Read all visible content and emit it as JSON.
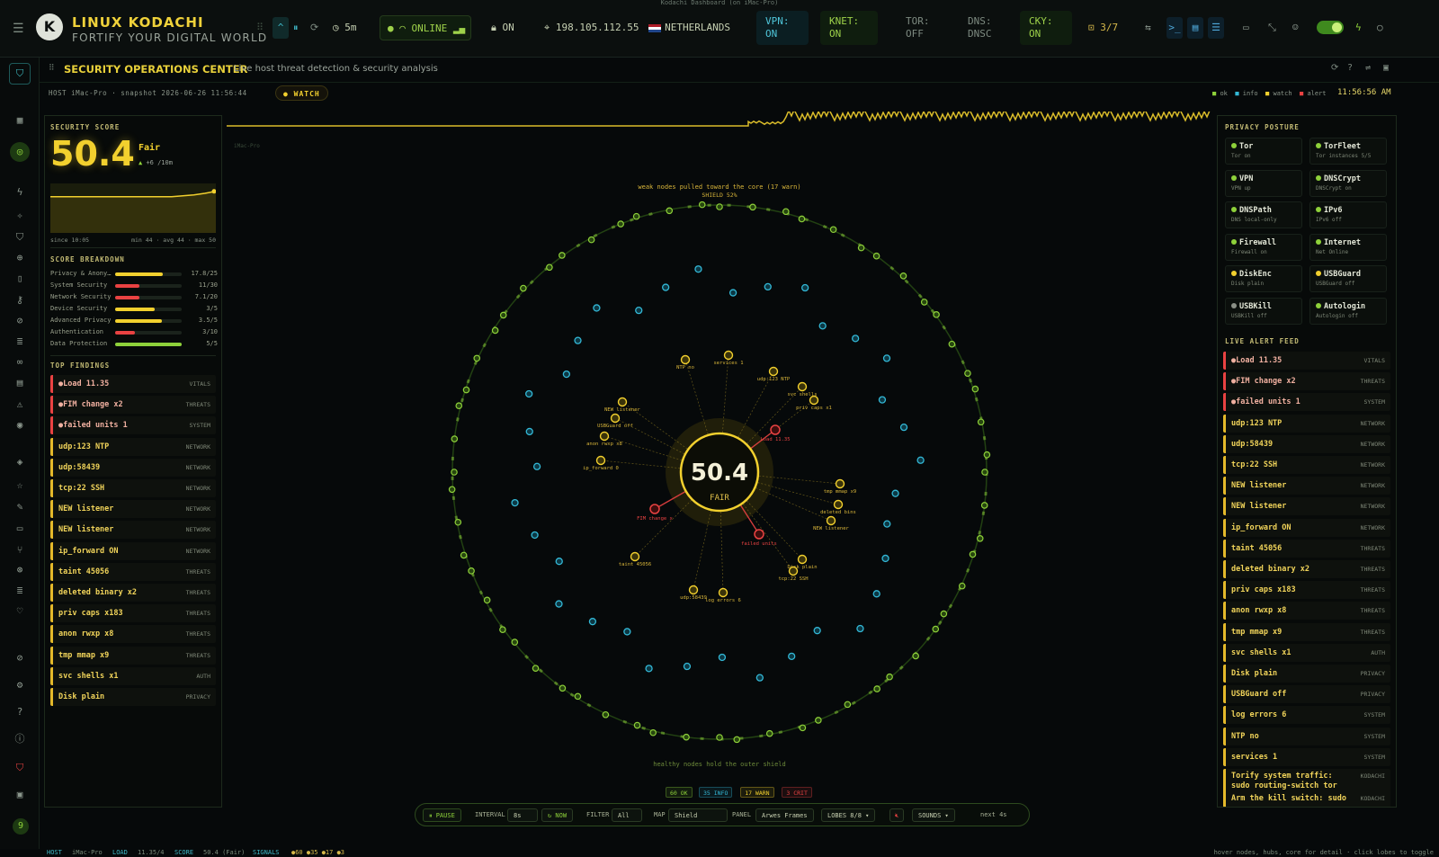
{
  "window_title": "Kodachi Dashboard (on iMac-Pro)",
  "brand": {
    "title": "LINUX KODACHI",
    "subtitle": "FORTIFY YOUR DIGITAL WORLD",
    "logo_letter": "K"
  },
  "topbar": {
    "interval": "5m",
    "online": "ONLINE",
    "lock": "ON",
    "ip": "198.105.112.55",
    "country": "NETHERLANDS",
    "vpn": "VPN:\nON",
    "knet": "KNET:\nON",
    "tor": "TOR:\nOFF",
    "dns": "DNS:\nDNSC",
    "cky": "CKY:\nON",
    "lock_count": "3/7"
  },
  "header": {
    "title": "SECURITY OPERATIONS CENTER",
    "subtitle": "Live host threat detection & security analysis"
  },
  "subheader": {
    "host_info": "HOST iMac-Pro · snapshot 2026-06-26 11:56:44",
    "status": "WATCH",
    "legend": [
      "ok",
      "info",
      "watch",
      "alert"
    ],
    "clock": "11:56:56 AM"
  },
  "score": {
    "label": "SECURITY SCORE",
    "value": "50.4",
    "grade": "Fair",
    "delta": "+6 /10m",
    "since": "since 10:05",
    "stats": "min 44 · avg 44 · max 50",
    "sparkline": [
      44,
      44,
      44,
      44,
      44,
      44,
      44,
      44,
      44,
      44,
      44,
      44,
      45,
      46,
      48,
      50.4
    ],
    "breakdown_title": "SCORE BREAKDOWN",
    "breakdown": [
      {
        "name": "Privacy & Anony…",
        "value": "17.8/25",
        "frac": 0.71,
        "color": "#f2d02e"
      },
      {
        "name": "System Security",
        "value": "11/30",
        "frac": 0.37,
        "color": "#e94242"
      },
      {
        "name": "Network Security",
        "value": "7.1/20",
        "frac": 0.36,
        "color": "#e94242"
      },
      {
        "name": "Device Security",
        "value": "3/5",
        "frac": 0.6,
        "color": "#f2d02e"
      },
      {
        "name": "Advanced Privacy",
        "value": "3.5/5",
        "frac": 0.7,
        "color": "#f2d02e"
      },
      {
        "name": "Authentication",
        "value": "3/10",
        "frac": 0.3,
        "color": "#e94242"
      },
      {
        "name": "Data Protection",
        "value": "5/5",
        "frac": 1.0,
        "color": "#8ed13a"
      }
    ]
  },
  "findings": {
    "title": "TOP FINDINGS",
    "items": [
      {
        "text": "●Load 11.35",
        "cat": "VITALS",
        "color": "#e94242"
      },
      {
        "text": "●FIM change x2",
        "cat": "THREATS",
        "color": "#e94242"
      },
      {
        "text": "●failed units 1",
        "cat": "SYSTEM",
        "color": "#e94242"
      },
      {
        "text": "udp:123 NTP",
        "cat": "NETWORK",
        "color": "#e4b92a"
      },
      {
        "text": "udp:58439",
        "cat": "NETWORK",
        "color": "#e4b92a"
      },
      {
        "text": "tcp:22 SSH",
        "cat": "NETWORK",
        "color": "#e4b92a"
      },
      {
        "text": "NEW listener",
        "cat": "NETWORK",
        "color": "#e4b92a"
      },
      {
        "text": "NEW listener",
        "cat": "NETWORK",
        "color": "#e4b92a"
      },
      {
        "text": "ip_forward ON",
        "cat": "NETWORK",
        "color": "#e4b92a"
      },
      {
        "text": "taint 45056",
        "cat": "THREATS",
        "color": "#e4b92a"
      },
      {
        "text": "deleted binary x2",
        "cat": "THREATS",
        "color": "#e4b92a"
      },
      {
        "text": "priv caps x183",
        "cat": "THREATS",
        "color": "#e4b92a"
      },
      {
        "text": "anon rwxp x8",
        "cat": "THREATS",
        "color": "#e4b92a"
      },
      {
        "text": "tmp mmap x9",
        "cat": "THREATS",
        "color": "#e4b92a"
      },
      {
        "text": "svc shells x1",
        "cat": "AUTH",
        "color": "#e4b92a"
      },
      {
        "text": "Disk plain",
        "cat": "PRIVACY",
        "color": "#e4b92a"
      }
    ]
  },
  "viz": {
    "top_note": "weak nodes pulled toward the core (17 warn)",
    "shield": "SHIELD 52%",
    "core_value": "50.4",
    "core_label": "FAIR",
    "bottom_note": "healthy nodes hold the outer shield",
    "host_tag": "iMac-Pro",
    "warn_nodes": [
      "NTP no",
      "services 1",
      "udp:123 NTP",
      "svc shells",
      "priv caps x1",
      "NEW listener",
      "USBGuard off",
      "anon rwxp x8",
      "ip_forward 0",
      "tmp mmap x9",
      "deleted bins",
      "NEW listener",
      "Disk plain",
      "tcp:22 SSH",
      "taint 45056",
      "udp:58439",
      "log errors 6"
    ],
    "alert_nodes": [
      "Load 11.35",
      "FIM change x",
      "failed units"
    ],
    "counts": [
      {
        "label": "60 OK",
        "color": "#8ed13a"
      },
      {
        "label": "35 INFO",
        "color": "#33b8d6"
      },
      {
        "label": "17 WARN",
        "color": "#f2d02e"
      },
      {
        "label": "3 CRIT",
        "color": "#e94242"
      }
    ]
  },
  "posture": {
    "title": "PRIVACY POSTURE",
    "items": [
      {
        "name": "Tor",
        "sub": "Tor on",
        "color": "#8ed13a"
      },
      {
        "name": "TorFleet",
        "sub": "Tor instances 5/5",
        "color": "#8ed13a"
      },
      {
        "name": "VPN",
        "sub": "VPN up",
        "color": "#8ed13a"
      },
      {
        "name": "DNSCrypt",
        "sub": "DNSCrypt on",
        "color": "#8ed13a"
      },
      {
        "name": "DNSPath",
        "sub": "DNS local-only",
        "color": "#8ed13a"
      },
      {
        "name": "IPv6",
        "sub": "IPv6 off",
        "color": "#8ed13a"
      },
      {
        "name": "Firewall",
        "sub": "Firewall on",
        "color": "#8ed13a"
      },
      {
        "name": "Internet",
        "sub": "Net Online",
        "color": "#8ed13a"
      },
      {
        "name": "DiskEnc",
        "sub": "Disk plain",
        "color": "#f2d02e"
      },
      {
        "name": "USBGuard",
        "sub": "USBGuard off",
        "color": "#f2d02e"
      },
      {
        "name": "USBKill",
        "sub": "USBKill off",
        "color": "#8a8f86"
      },
      {
        "name": "Autologin",
        "sub": "Autologin off",
        "color": "#8ed13a"
      }
    ]
  },
  "feed": {
    "title": "LIVE ALERT FEED",
    "items": [
      {
        "text": "●Load 11.35",
        "cat": "VITALS",
        "color": "#e94242"
      },
      {
        "text": "●FIM change x2",
        "cat": "THREATS",
        "color": "#e94242"
      },
      {
        "text": "●failed units 1",
        "cat": "SYSTEM",
        "color": "#e94242"
      },
      {
        "text": "udp:123 NTP",
        "cat": "NETWORK",
        "color": "#e4b92a"
      },
      {
        "text": "udp:58439",
        "cat": "NETWORK",
        "color": "#e4b92a"
      },
      {
        "text": "tcp:22 SSH",
        "cat": "NETWORK",
        "color": "#e4b92a"
      },
      {
        "text": "NEW listener",
        "cat": "NETWORK",
        "color": "#e4b92a"
      },
      {
        "text": "NEW listener",
        "cat": "NETWORK",
        "color": "#e4b92a"
      },
      {
        "text": "ip_forward ON",
        "cat": "NETWORK",
        "color": "#e4b92a"
      },
      {
        "text": "taint 45056",
        "cat": "THREATS",
        "color": "#e4b92a"
      },
      {
        "text": "deleted binary x2",
        "cat": "THREATS",
        "color": "#e4b92a"
      },
      {
        "text": "priv caps x183",
        "cat": "THREATS",
        "color": "#e4b92a"
      },
      {
        "text": "anon rwxp x8",
        "cat": "THREATS",
        "color": "#e4b92a"
      },
      {
        "text": "tmp mmap x9",
        "cat": "THREATS",
        "color": "#e4b92a"
      },
      {
        "text": "svc shells x1",
        "cat": "AUTH",
        "color": "#e4b92a"
      },
      {
        "text": "Disk plain",
        "cat": "PRIVACY",
        "color": "#e4b92a"
      },
      {
        "text": "USBGuard off",
        "cat": "PRIVACY",
        "color": "#e4b92a"
      },
      {
        "text": "log errors 6",
        "cat": "SYSTEM",
        "color": "#e4b92a"
      },
      {
        "text": "NTP no",
        "cat": "SYSTEM",
        "color": "#e4b92a"
      },
      {
        "text": "services 1",
        "cat": "SYSTEM",
        "color": "#e4b92a"
      },
      {
        "text": "Torify system traffic: sudo routing-switch tor",
        "cat": "KODACHI",
        "color": "#e4b92a"
      },
      {
        "text": "Arm the kill switch: sudo",
        "cat": "KODACHI",
        "color": "#e4b92a"
      }
    ]
  },
  "controls": {
    "pause": "⏸ PAUSE",
    "interval_label": "INTERVAL",
    "interval_value": "8s",
    "now": "↻ NOW",
    "filter_label": "FILTER",
    "filter_value": "All",
    "map_label": "MAP",
    "map_value": "Shield",
    "panel_label": "PANEL",
    "panel_value": "Arwes Frames",
    "lobes": "LOBES 8/8 ▾",
    "sounds": "SOUNDS ▾",
    "next": "next 4s"
  },
  "statusbar": {
    "host_label": "HOST",
    "host": "iMac-Pro",
    "load_label": "LOAD",
    "load": "11.35/4",
    "score_label": "SCORE",
    "score": "50.4 (Fair)",
    "signals_label": "SIGNALS",
    "signals": "●60 ●35 ●17 ●3",
    "hint": "hover nodes, hubs, core for detail · click lobes to toggle"
  },
  "sidebar_badge": "9",
  "colors": {
    "ok": "#8ed13a",
    "info": "#33b8d6",
    "watch": "#f2d02e",
    "alert": "#e94242"
  }
}
